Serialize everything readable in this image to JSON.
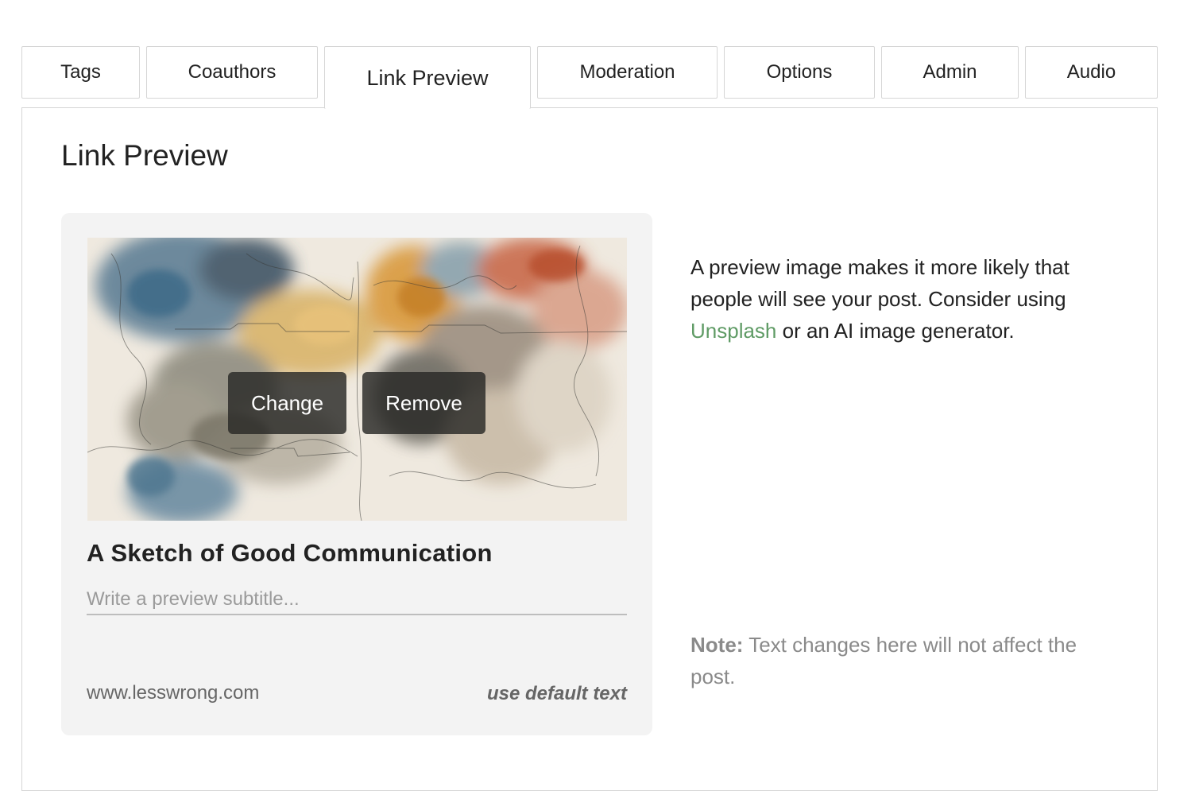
{
  "tabs": [
    {
      "label": "Tags",
      "active": false
    },
    {
      "label": "Coauthors",
      "active": false
    },
    {
      "label": "Link Preview",
      "active": true
    },
    {
      "label": "Moderation",
      "active": false
    },
    {
      "label": "Options",
      "active": false
    },
    {
      "label": "Admin",
      "active": false
    },
    {
      "label": "Audio",
      "active": false
    }
  ],
  "panel": {
    "title": "Link Preview"
  },
  "card": {
    "image_buttons": {
      "change_label": "Change",
      "remove_label": "Remove"
    },
    "post_title": "A Sketch of Good Communication",
    "subtitle_value": "",
    "subtitle_placeholder": "Write a preview subtitle...",
    "domain": "www.lesswrong.com",
    "default_text_link": "use default text"
  },
  "help": {
    "text_before": "A preview image makes it more likely that people will see your post. Consider using ",
    "link_label": "Unsplash",
    "text_after": " or an AI image generator."
  },
  "note": {
    "label": "Note:",
    "text": " Text changes here will not affect the post."
  },
  "colors": {
    "link_green": "#5f9b65",
    "card_bg": "#f3f3f3",
    "tab_border": "#d6d6d6"
  }
}
